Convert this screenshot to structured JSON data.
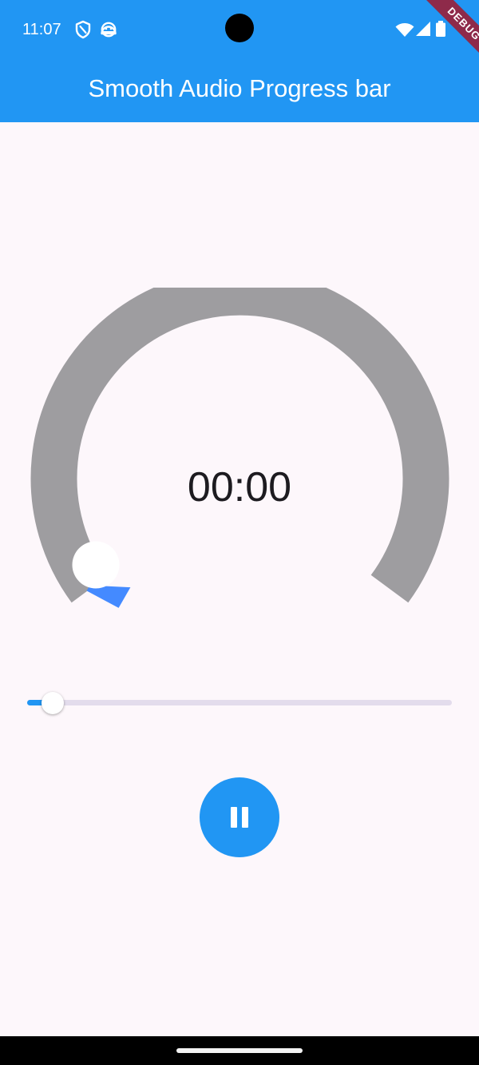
{
  "status_bar": {
    "time": "11:07",
    "left_icons": [
      "shield-icon",
      "android-robot-icon"
    ],
    "right_icons": [
      "wifi-icon",
      "cell-signal-icon",
      "battery-icon"
    ]
  },
  "debug_banner": {
    "label": "DEBUG"
  },
  "app_bar": {
    "title": "Smooth Audio Progress bar"
  },
  "player": {
    "elapsed_time": "00:00",
    "progress_fraction": 0.06,
    "circular_progress_fraction": 0.0,
    "control_icon": "pause-icon"
  },
  "colors": {
    "app_bar": "#2196f3",
    "accent": "#2196f3",
    "gauge_track": "#9e9da0",
    "gauge_progress": "#448aff",
    "background": "#fdf7fb",
    "debug_banner": "#8e2a4a"
  }
}
